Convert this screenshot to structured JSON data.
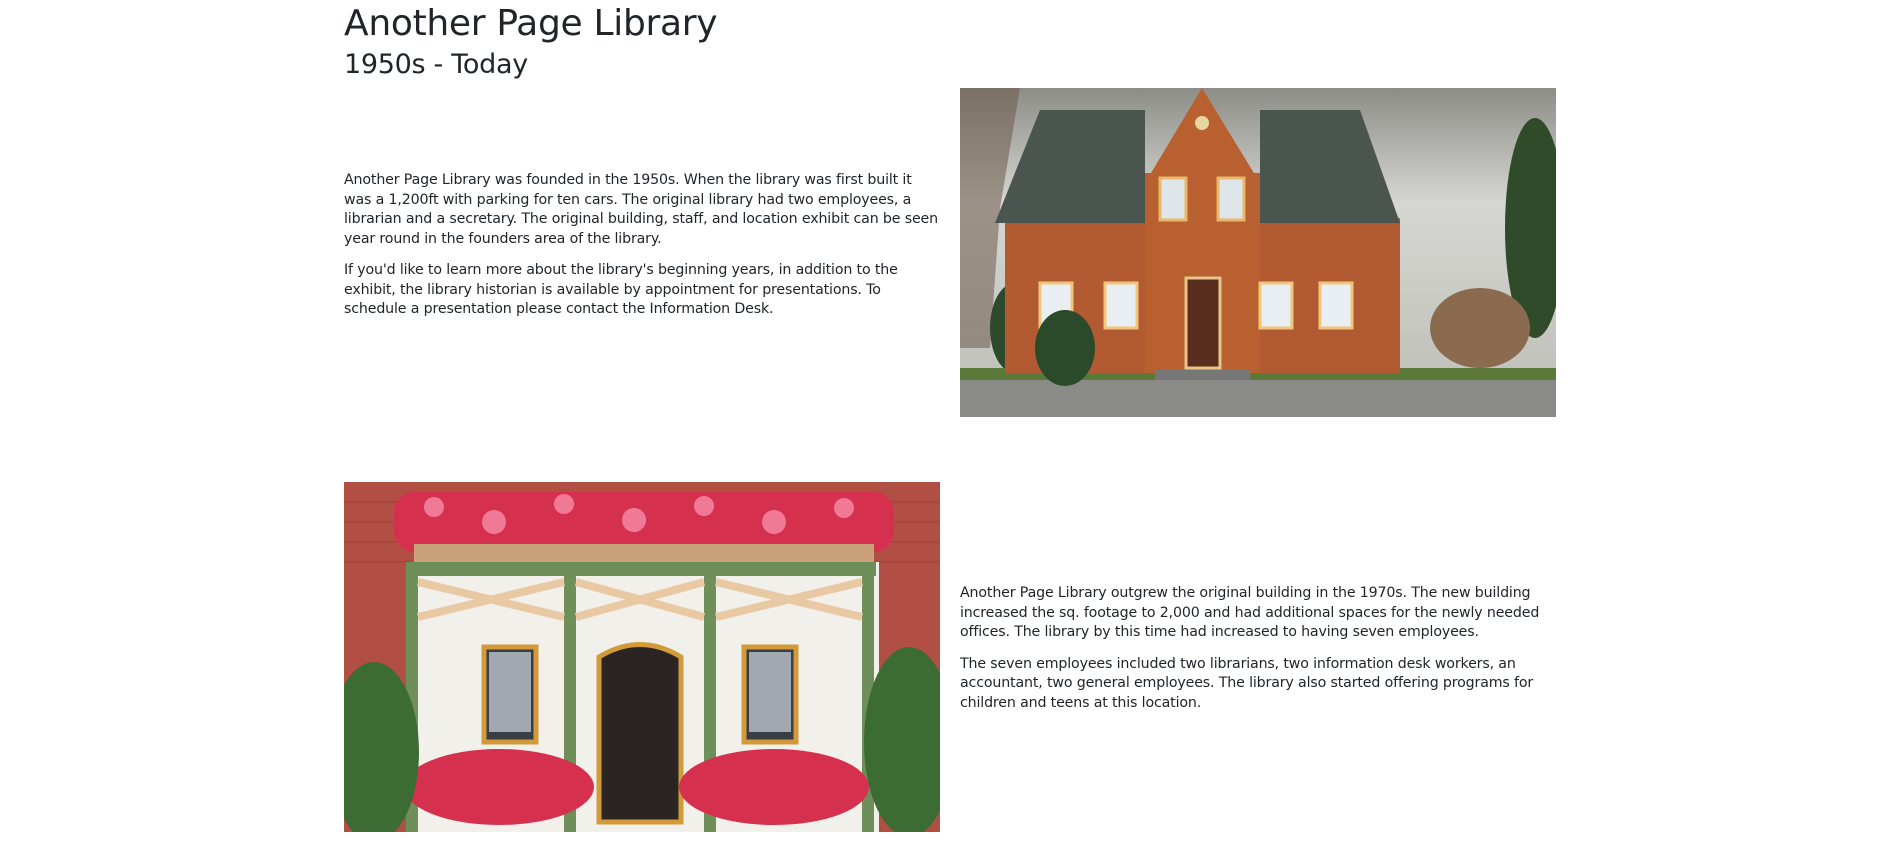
{
  "header": {
    "title": "Another Page Library",
    "subtitle": "1950s - Today"
  },
  "sections": [
    {
      "paragraphs": [
        "Another Page Library was founded in the 1950s. When the library was first built it was a 1,200ft with parking for ten cars. The original library had two employees, a librarian and a secretary. The original building, staff, and location exhibit can be seen year round in the founders area of the library.",
        "If you'd like to learn more about the library's beginning years, in addition to the exhibit, the library historian is available by appointment for presentations. To schedule a presentation please contact the Information Desk."
      ]
    },
    {
      "paragraphs": [
        "Another Page Library outgrew the original building in the 1970s. The new building increased the sq. footage to 2,000 and had additional spaces for the newly needed offices. The library by this time had increased to having seven employees.",
        "The seven employees included two librarians, two information desk workers, an accountant, two general employees. The library also started offering programs for children and teens at this location."
      ]
    }
  ],
  "colors": {
    "text": "#212529",
    "background": "#ffffff",
    "brick": "#b5574a",
    "roof": "#4f5a54",
    "trim_green": "#6f8f5a",
    "flowers": "#d6304f"
  }
}
